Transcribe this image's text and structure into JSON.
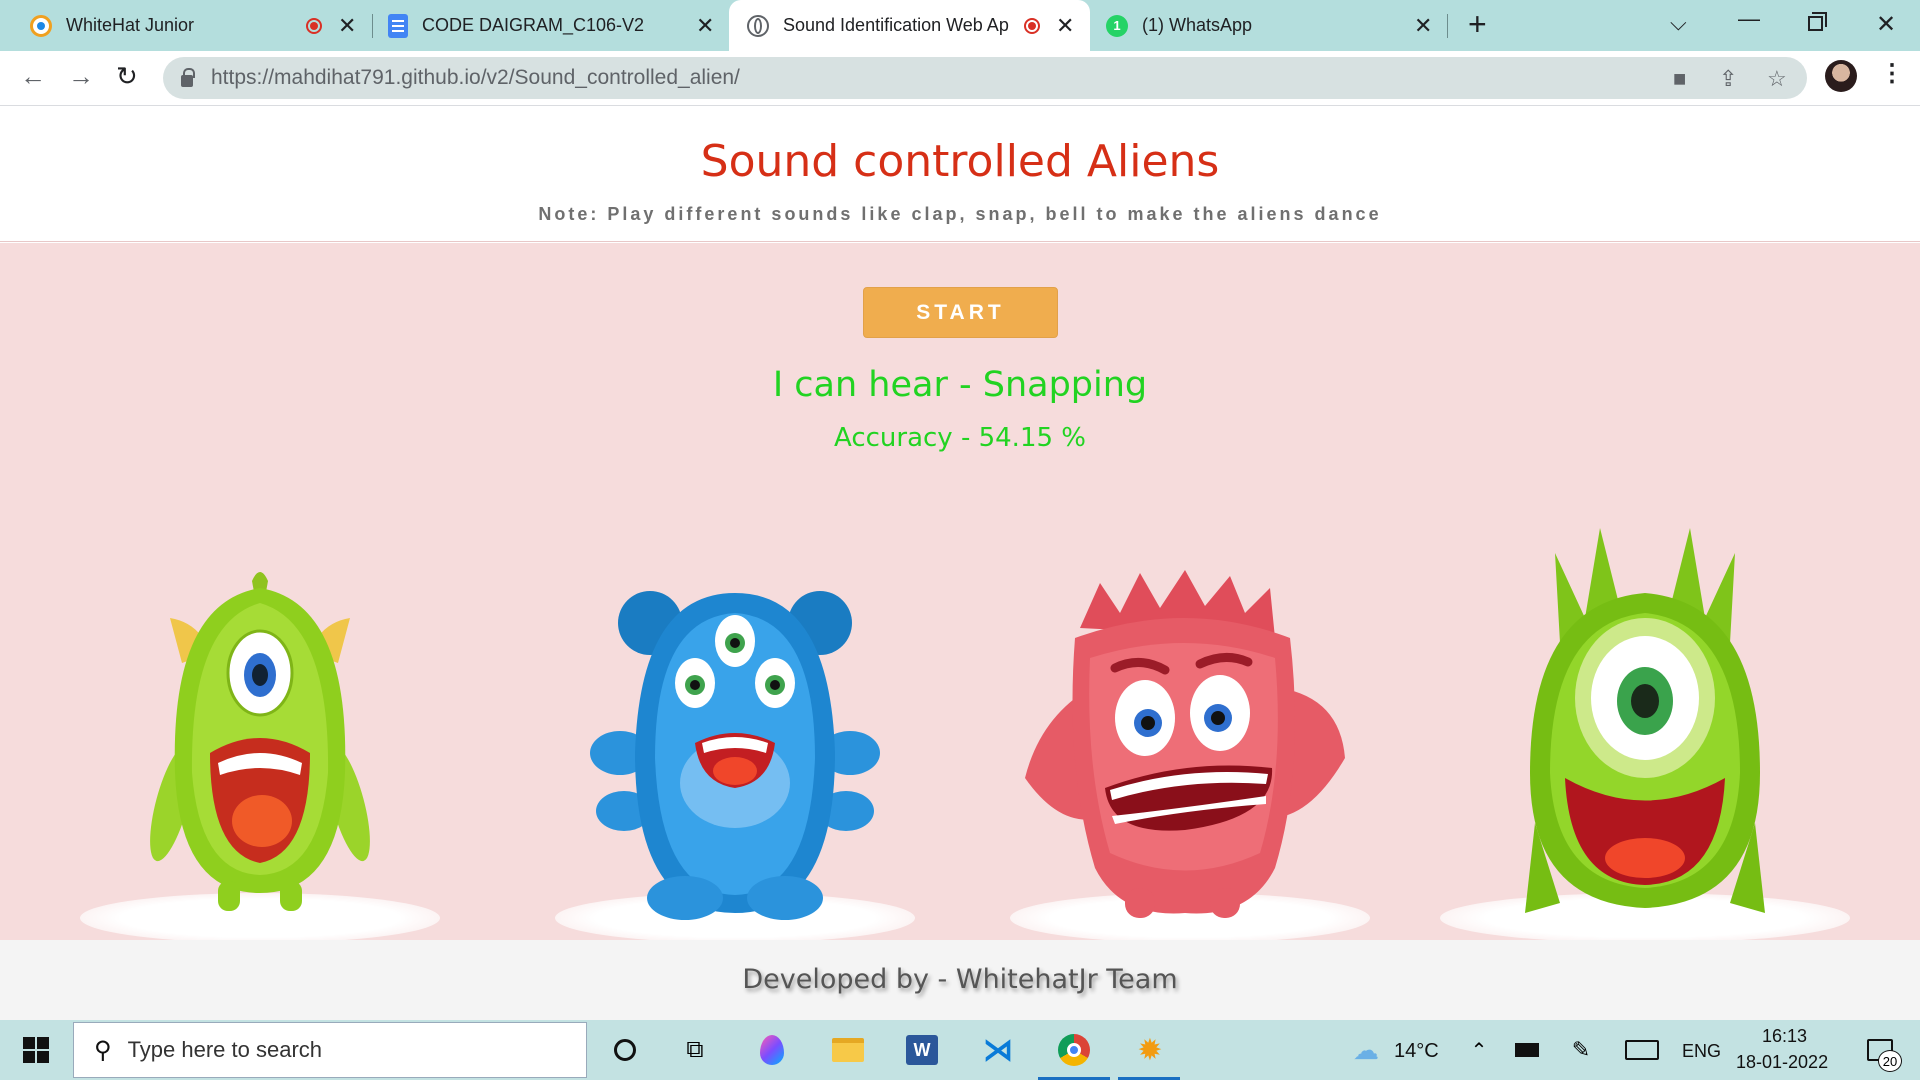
{
  "browser": {
    "tabs": [
      {
        "title": "WhiteHat Junior",
        "icon": "whitehat-icon",
        "recording": true
      },
      {
        "title": "CODE DAIGRAM_C106-V2",
        "icon": "google-docs-icon",
        "recording": false
      },
      {
        "title": "Sound Identification Web Ap",
        "icon": "globe-icon",
        "recording": true,
        "active": true
      },
      {
        "title": "(1) WhatsApp",
        "icon": "whatsapp-icon",
        "recording": false
      }
    ],
    "url_host": "https://mahdihat791.github.io",
    "url_path": "/v2/Sound_controlled_alien/"
  },
  "page": {
    "title": "Sound controlled Aliens",
    "note": "Note: Play different sounds like clap, snap, bell to make the aliens dance",
    "start_label": "START",
    "hear_text": "I can hear - Snapping",
    "accuracy_text": "Accuracy - 54.15 %",
    "footer": "Developed by - WhitehatJr Team",
    "title_color": "#d62f16",
    "result_color": "#22d322",
    "button_color": "#f0ad4e",
    "stage_color": "#f6dcdc"
  },
  "taskbar": {
    "search_placeholder": "Type here to search",
    "temperature": "14°C",
    "language": "ENG",
    "time": "16:13",
    "date": "18-01-2022",
    "notification_count": "20"
  }
}
